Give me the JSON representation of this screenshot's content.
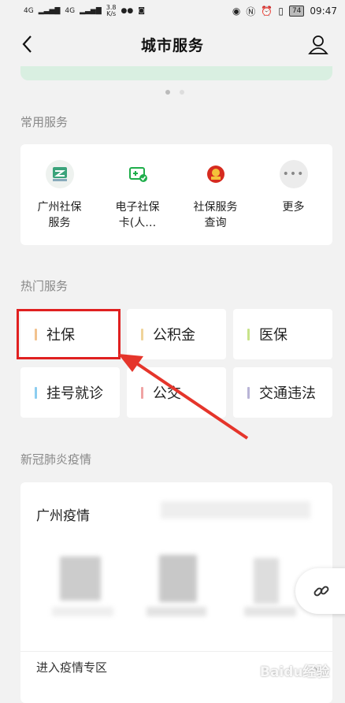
{
  "status_bar": {
    "signal1": "4G",
    "signal2": "4G",
    "speed_value": "3.8",
    "speed_unit": "K/s",
    "battery": "74",
    "time": "09:47"
  },
  "header": {
    "title": "城市服务"
  },
  "banner": {
    "page_indicator_active": 1,
    "page_count": 2
  },
  "common_services": {
    "title": "常用服务",
    "items": [
      {
        "label_line1": "广州社保",
        "label_line2": "服务",
        "icon": "social-security-icon"
      },
      {
        "label_line1": "电子社保",
        "label_line2": "卡(人…",
        "icon": "e-card-icon"
      },
      {
        "label_line1": "社保服务",
        "label_line2": "查询",
        "icon": "national-emblem-icon"
      },
      {
        "label_line1": "更多",
        "label_line2": "",
        "icon": "more-icon"
      }
    ]
  },
  "hot_services": {
    "title": "热门服务",
    "items": [
      {
        "label": "社保",
        "bar_color": "#f2c28e"
      },
      {
        "label": "公积金",
        "bar_color": "#f0d49a"
      },
      {
        "label": "医保",
        "bar_color": "#c8e38a"
      },
      {
        "label": "挂号就诊",
        "bar_color": "#8ccdf0"
      },
      {
        "label": "公交",
        "bar_color": "#f0a3a3"
      },
      {
        "label": "交通违法",
        "bar_color": "#b9b4d6"
      }
    ]
  },
  "covid": {
    "section_title": "新冠肺炎疫情",
    "card_title": "广州疫情",
    "enter_label": "进入疫情专区"
  },
  "watermark": "Baidu经验"
}
